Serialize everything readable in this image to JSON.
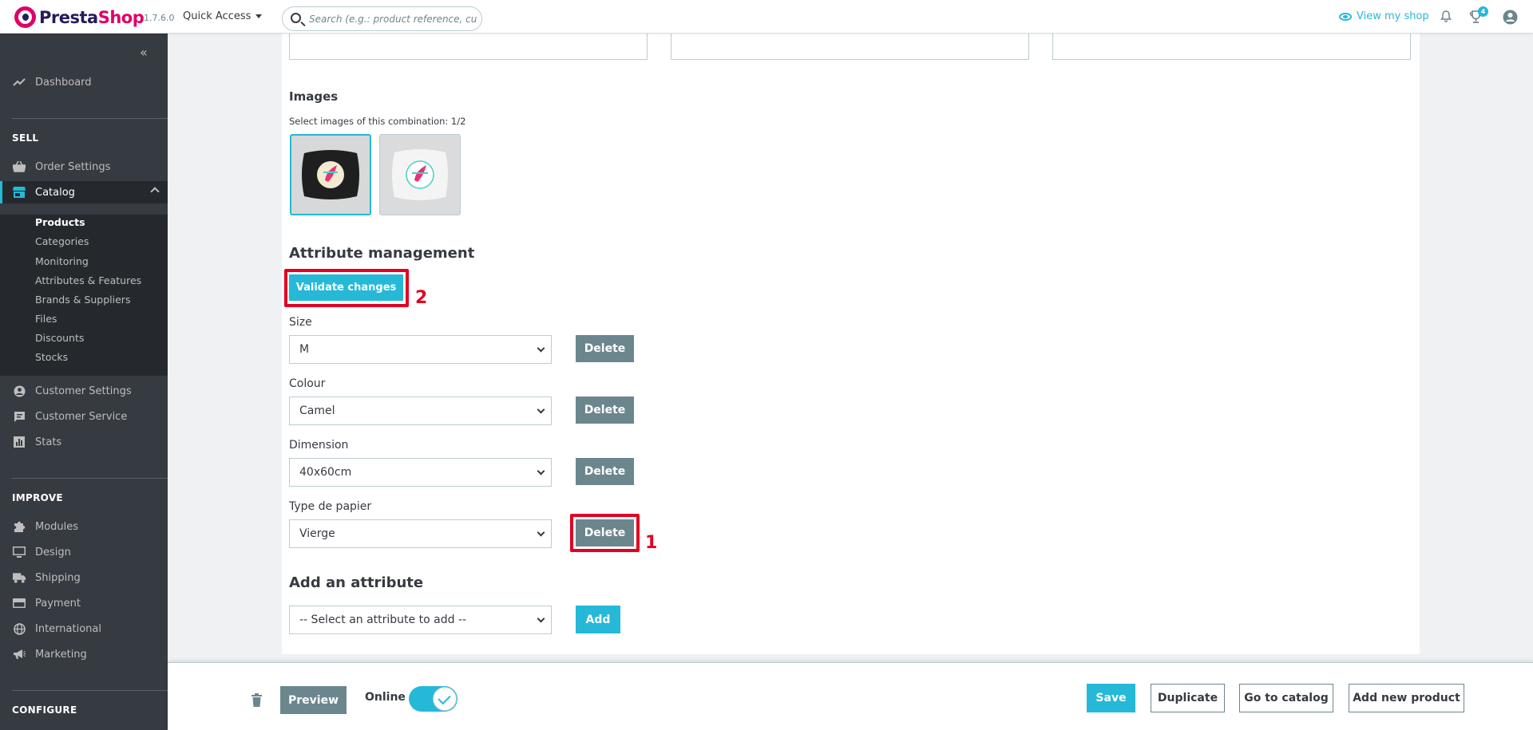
{
  "header": {
    "logo_text_1": "Presta",
    "logo_text_2": "Shop",
    "version": "1.7.6.0",
    "quick_access": "Quick Access",
    "search_placeholder": "Search (e.g.: product reference, customer name...)",
    "view_shop": "View my shop",
    "notifications_badge": "4"
  },
  "sidebar": {
    "dashboard": "Dashboard",
    "sell_title": "SELL",
    "orders": "Order Settings",
    "catalog": "Catalog",
    "catalog_sub": [
      "Products",
      "Categories",
      "Monitoring",
      "Attributes & Features",
      "Brands & Suppliers",
      "Files",
      "Discounts",
      "Stocks"
    ],
    "customers": "Customer Settings",
    "customer_service": "Customer Service",
    "stats": "Stats",
    "improve_title": "IMPROVE",
    "modules": "Modules",
    "design": "Design",
    "shipping": "Shipping",
    "payment": "Payment",
    "international": "International",
    "marketing": "Marketing",
    "configure_title": "CONFIGURE"
  },
  "images": {
    "title": "Images",
    "help": "Select images of this combination: 1/2"
  },
  "attribute_management": {
    "title": "Attribute management",
    "validate_button": "Validate changes",
    "annotation_validate": "2",
    "annotation_delete": "1",
    "attributes": [
      {
        "label": "Size",
        "value": "M",
        "delete": "Delete"
      },
      {
        "label": "Colour",
        "value": "Camel",
        "delete": "Delete"
      },
      {
        "label": "Dimension",
        "value": "40x60cm",
        "delete": "Delete"
      },
      {
        "label": "Type de papier",
        "value": "Vierge",
        "delete": "Delete"
      }
    ]
  },
  "add_attribute": {
    "title": "Add an attribute",
    "select_value": "-- Select an attribute to add --",
    "add_button": "Add"
  },
  "footer": {
    "preview": "Preview",
    "online": "Online",
    "save": "Save",
    "duplicate": "Duplicate",
    "go_to_catalog": "Go to catalog",
    "add_new_product": "Add new product"
  },
  "colors": {
    "primary": "#25b9d7",
    "secondary": "#6c868e",
    "sidebar": "#363a41",
    "brand": "#df0067",
    "annotation": "#e30022"
  }
}
